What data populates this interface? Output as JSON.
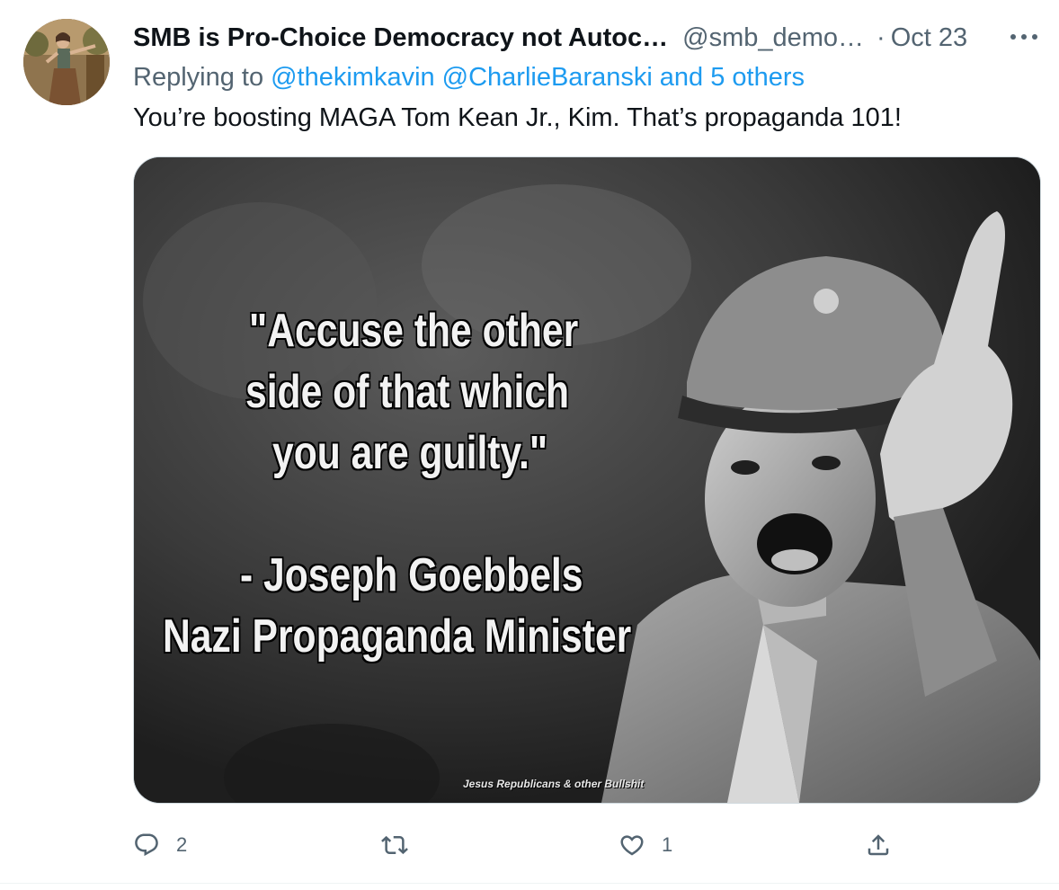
{
  "tweet": {
    "display_name": "SMB is Pro-Choice Democracy not Autoc…",
    "handle": "@smb_demo…",
    "separator": "·",
    "date": "Oct 23",
    "more_label": "•••",
    "replying_prefix": "Replying to",
    "mention_1": "@thekimkavin",
    "mention_2": "@CharlieBaranski",
    "mention_3": "and 5 others",
    "text": "You’re boosting MAGA Tom Kean Jr., Kim. That’s propaganda 101!"
  },
  "media": {
    "quote_line_1": "\"Accuse the other",
    "quote_line_2": "side of that which",
    "quote_line_3": "you are guilty.\"",
    "attribution_1": "- Joseph Goebbels",
    "attribution_2": "Nazi Propaganda Minister",
    "watermark": "Jesus Republicans & other Bullshit"
  },
  "actions": {
    "reply_count": "2",
    "retweet_count": "",
    "like_count": "1",
    "share_count": ""
  },
  "icons": {
    "reply": "reply-icon",
    "retweet": "retweet-icon",
    "like": "heart-icon",
    "share": "share-icon",
    "more": "more-icon"
  },
  "colors": {
    "link": "#1d9bf0",
    "secondary_text": "#536471",
    "primary_text": "#0f1419"
  }
}
